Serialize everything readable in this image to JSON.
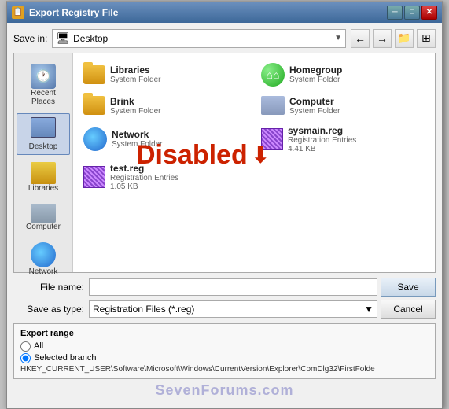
{
  "window": {
    "title": "Export Registry File",
    "close_label": "✕",
    "min_label": "─",
    "max_label": "□"
  },
  "toolbar": {
    "save_in_label": "Save in:",
    "save_in_value": "Desktop",
    "back_btn": "←",
    "forward_btn": "→",
    "up_btn": "↑",
    "new_folder_btn": "📁",
    "views_btn": "⊞"
  },
  "sidebar": {
    "items": [
      {
        "id": "recent-places",
        "label": "Recent Places",
        "selected": false
      },
      {
        "id": "desktop",
        "label": "Desktop",
        "selected": true
      },
      {
        "id": "libraries",
        "label": "Libraries",
        "selected": false
      },
      {
        "id": "computer",
        "label": "Computer",
        "selected": false
      },
      {
        "id": "network",
        "label": "Network",
        "selected": false
      }
    ]
  },
  "files": [
    {
      "id": "libraries",
      "name": "Libraries",
      "type": "System Folder",
      "icon": "folder-yellow"
    },
    {
      "id": "homegroup",
      "name": "Homegroup",
      "type": "System Folder",
      "icon": "homegroup"
    },
    {
      "id": "brink",
      "name": "Brink",
      "type": "System Folder",
      "icon": "folder-person"
    },
    {
      "id": "computer",
      "name": "Computer",
      "type": "System Folder",
      "icon": "computer"
    },
    {
      "id": "network",
      "name": "Network",
      "type": "System Folder",
      "icon": "network"
    },
    {
      "id": "sysmain",
      "name": "sysmain.reg",
      "type": "Registration Entries",
      "size": "4.41 KB",
      "icon": "reg"
    },
    {
      "id": "testreg",
      "name": "test.reg",
      "type": "Registration Entries",
      "size": "1.05 KB",
      "icon": "reg"
    }
  ],
  "overlay": {
    "text": "Disabled",
    "arrow": "⬇"
  },
  "fields": {
    "filename_label": "File name:",
    "filename_value": "",
    "savetype_label": "Save as type:",
    "savetype_value": "Registration Files (*.reg)"
  },
  "buttons": {
    "save": "Save",
    "cancel": "Cancel"
  },
  "export_range": {
    "title": "Export range",
    "all_label": "All",
    "selected_label": "Selected branch",
    "branch_path": "HKEY_CURRENT_USER\\Software\\Microsoft\\Windows\\CurrentVersion\\Explorer\\ComDlg32\\FirstFolde"
  },
  "watermark": {
    "text": "SevenForums.com"
  }
}
